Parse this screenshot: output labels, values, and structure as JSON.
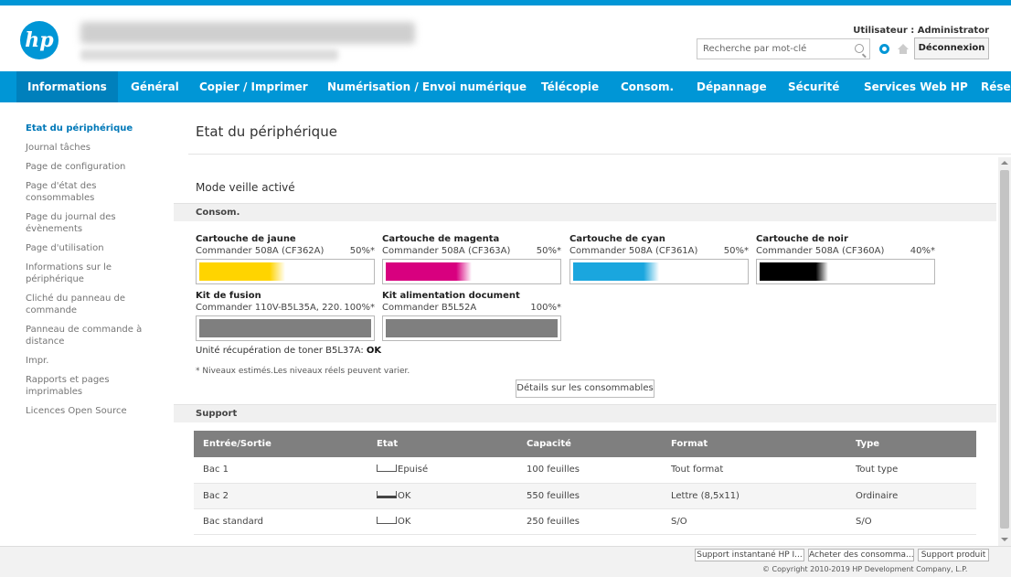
{
  "header": {
    "logo_text": "hp",
    "user_label": "Utilisateur : Administrator",
    "search_placeholder": "Recherche par mot-clé",
    "logout_label": "Déconnexion",
    "brand_color": "#0096d6"
  },
  "nav": {
    "tabs": [
      {
        "label": "Informations",
        "active": true
      },
      {
        "label": "Général"
      },
      {
        "label": "Copier / Imprimer"
      },
      {
        "label": "Numérisation / Envoi numérique"
      },
      {
        "label": "Télécopie"
      },
      {
        "label": "Consom."
      },
      {
        "label": "Dépannage"
      },
      {
        "label": "Sécurité"
      },
      {
        "label": "Services Web HP"
      },
      {
        "label": "Rése"
      }
    ]
  },
  "sidebar": {
    "items": [
      {
        "label": "Etat du périphérique",
        "active": true
      },
      {
        "label": "Journal tâches"
      },
      {
        "label": "Page de configuration"
      },
      {
        "label": "Page d'état des consommables"
      },
      {
        "label": "Page du journal des évènements"
      },
      {
        "label": "Page d'utilisation"
      },
      {
        "label": "Informations sur le périphérique"
      },
      {
        "label": "Cliché du panneau de commande"
      },
      {
        "label": "Panneau de commande à distance"
      },
      {
        "label": "Impr."
      },
      {
        "label": "Rapports et pages imprimables"
      },
      {
        "label": "Licences Open Source"
      }
    ]
  },
  "main": {
    "title": "Etat du périphérique",
    "mode": "Mode veille activé",
    "supplies_header": "Consom.",
    "cartridges": [
      {
        "name": "Cartouche de jaune",
        "model": "Commander 508A (CF362A)",
        "percent": "50%*",
        "level": 0.5,
        "color": "#ffd400"
      },
      {
        "name": "Cartouche de magenta",
        "model": "Commander 508A (CF363A)",
        "percent": "50%*",
        "level": 0.5,
        "color": "#d8007f"
      },
      {
        "name": "Cartouche de cyan",
        "model": "Commander 508A (CF361A)",
        "percent": "50%*",
        "level": 0.5,
        "color": "#1aa6de"
      },
      {
        "name": "Cartouche de noir",
        "model": "Commander 508A (CF360A)",
        "percent": "40%*",
        "level": 0.4,
        "color": "#000000"
      },
      {
        "name": "Kit de fusion",
        "model": "Commander 110V-B5L35A, 220...",
        "percent": "100%*",
        "level": 1.0,
        "color": "#7f7f7f"
      },
      {
        "name": "Kit alimentation document",
        "model": "Commander B5L52A",
        "percent": "100%*",
        "level": 1.0,
        "color": "#7f7f7f"
      }
    ],
    "toner_unit_label": "Unité récupération de toner B5L37A:",
    "toner_unit_status": "OK",
    "note": "* Niveaux estimés.Les niveaux réels peuvent varier.",
    "details_button": "Détails sur les consommables",
    "support_header": "Support",
    "table": {
      "columns": [
        "Entrée/Sortie",
        "Etat",
        "Capacité",
        "Format",
        "Type"
      ],
      "rows": [
        {
          "io": "Bac 1",
          "state": "Epuisé",
          "fill": "empty",
          "capacity": "100 feuilles",
          "format": "Tout format",
          "type": "Tout type"
        },
        {
          "io": "Bac 2",
          "state": "OK",
          "fill": "full",
          "capacity": "550 feuilles",
          "format": "Lettre (8,5x11)",
          "type": "Ordinaire"
        },
        {
          "io": "Bac standard",
          "state": "OK",
          "fill": "empty",
          "capacity": "250 feuilles",
          "format": "S/O",
          "type": "S/O"
        }
      ]
    }
  },
  "footer": {
    "buttons": [
      "Support instantané HP I...",
      "Acheter des consomma...",
      "Support produit"
    ],
    "copyright": "© Copyright 2010-2019 HP Development Company, L.P."
  }
}
